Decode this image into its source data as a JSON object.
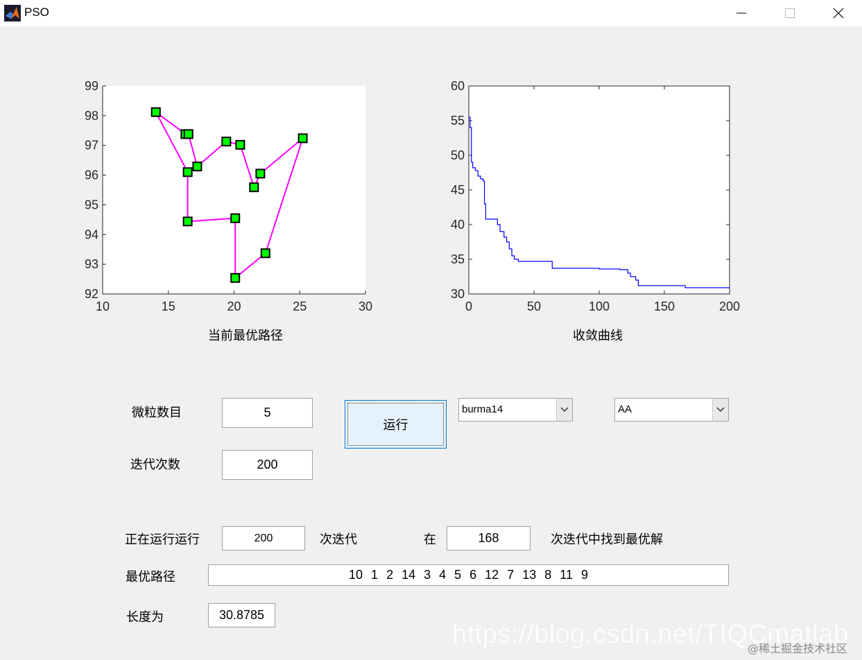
{
  "window": {
    "title": "PSO",
    "controls": [
      "minimize-icon",
      "maximize-icon",
      "close-icon"
    ]
  },
  "plot_left": {
    "caption": "当前最优路径",
    "chart_data": {
      "type": "line",
      "x_ticks": [
        "10",
        "15",
        "20",
        "25",
        "30"
      ],
      "y_ticks": [
        "92",
        "93",
        "94",
        "95",
        "96",
        "97",
        "98",
        "99"
      ],
      "xlim": [
        10,
        30
      ],
      "ylim": [
        92,
        99
      ],
      "route_order": [
        10,
        1,
        2,
        14,
        3,
        4,
        5,
        6,
        12,
        7,
        13,
        8,
        11,
        9,
        10
      ],
      "points": [
        {
          "city": 1,
          "x": 16.47,
          "y": 96.1
        },
        {
          "city": 2,
          "x": 16.47,
          "y": 94.44
        },
        {
          "city": 3,
          "x": 20.09,
          "y": 92.54
        },
        {
          "city": 4,
          "x": 22.39,
          "y": 93.37
        },
        {
          "city": 5,
          "x": 25.23,
          "y": 97.24
        },
        {
          "city": 6,
          "x": 22.0,
          "y": 96.05
        },
        {
          "city": 7,
          "x": 20.47,
          "y": 97.02
        },
        {
          "city": 8,
          "x": 17.2,
          "y": 96.29
        },
        {
          "city": 9,
          "x": 16.3,
          "y": 97.38
        },
        {
          "city": 10,
          "x": 14.05,
          "y": 98.12
        },
        {
          "city": 11,
          "x": 16.53,
          "y": 97.38
        },
        {
          "city": 12,
          "x": 21.52,
          "y": 95.59
        },
        {
          "city": 13,
          "x": 19.41,
          "y": 97.13
        },
        {
          "city": 14,
          "x": 20.09,
          "y": 94.55
        }
      ],
      "line_color": "#ff00ff",
      "marker_color": "#00ff00",
      "grid": false
    }
  },
  "plot_right": {
    "caption": "收敛曲线",
    "chart_data": {
      "type": "line",
      "x_ticks": [
        "0",
        "50",
        "100",
        "150",
        "200"
      ],
      "y_ticks": [
        "30",
        "35",
        "40",
        "45",
        "50",
        "55",
        "60"
      ],
      "xlim": [
        0,
        200
      ],
      "ylim": [
        30,
        60
      ],
      "line_color": "#0000ff",
      "grid": false,
      "series": [
        {
          "x": [
            0,
            1,
            2,
            3,
            5,
            7,
            9,
            11,
            12,
            13,
            20,
            22,
            24,
            27,
            29,
            31,
            33,
            35,
            38,
            63,
            64,
            100,
            116,
            122,
            124,
            128,
            130,
            165,
            166,
            200
          ],
          "y": [
            55.5,
            54.0,
            49.0,
            48.2,
            47.8,
            47.0,
            46.6,
            46.3,
            43.0,
            40.8,
            40.8,
            40.0,
            39.0,
            38.2,
            37.5,
            36.5,
            35.5,
            35.0,
            34.7,
            34.7,
            33.7,
            33.6,
            33.5,
            33.0,
            32.5,
            32.0,
            31.2,
            31.2,
            30.9,
            30.9
          ]
        }
      ]
    }
  },
  "form": {
    "particles_label": "微粒数目",
    "particles_value": "5",
    "iterations_label": "迭代次数",
    "iterations_value": "200",
    "run_label": "运行",
    "dataset_dropdown": "burma14",
    "algo_dropdown": "AA"
  },
  "status": {
    "running_label": "正在运行运行",
    "running_value": "200",
    "iter_suffix": "次迭代",
    "at_label": "在",
    "found_value": "168",
    "found_suffix": "次迭代中找到最优解",
    "best_path_label": "最优路径",
    "best_path": [
      "10",
      "1",
      "2",
      "14",
      "3",
      "4",
      "5",
      "6",
      "12",
      "7",
      "13",
      "8",
      "11",
      "9"
    ],
    "length_label": "长度为",
    "length_value": "30.8785"
  },
  "watermark": {
    "url": "https://blog.csdn.net/TIQCmatlab",
    "community": "@稀土掘金技术社区"
  }
}
